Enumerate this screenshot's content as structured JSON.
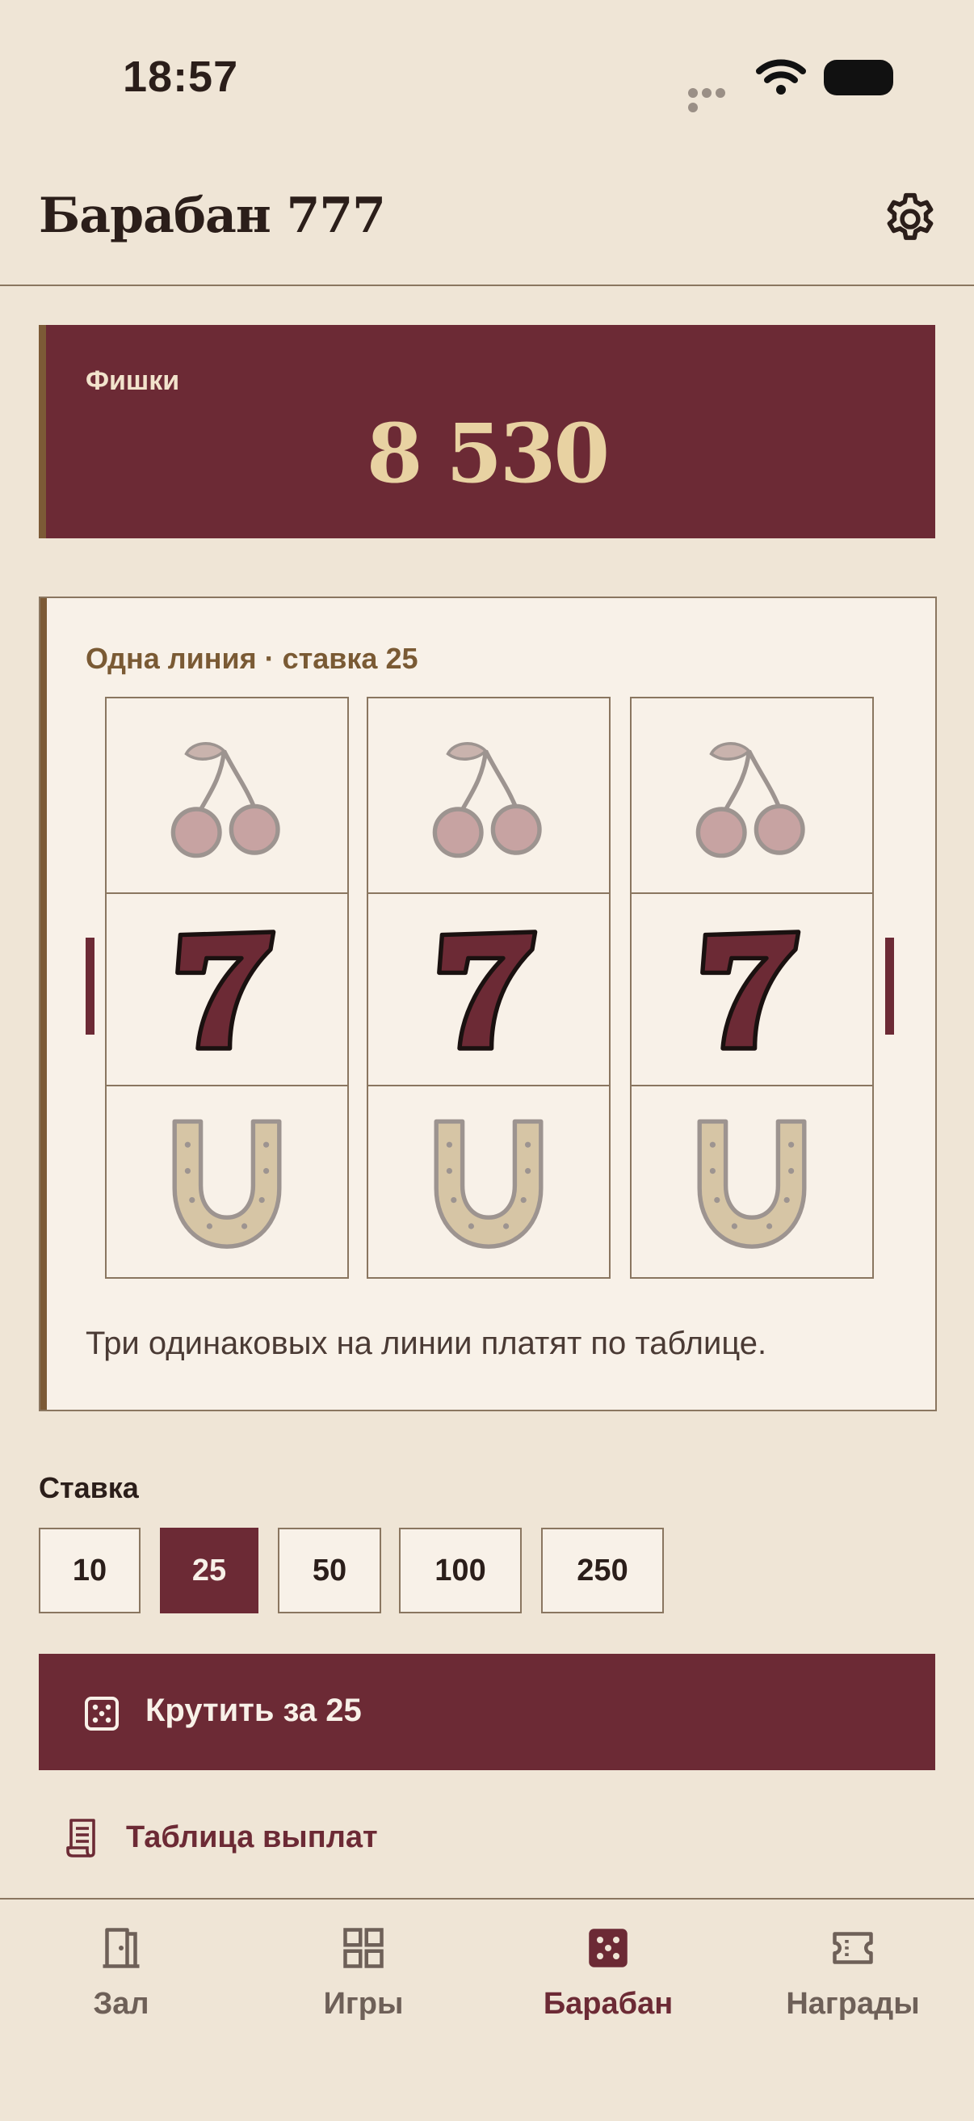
{
  "status_bar": {
    "time": "18:57"
  },
  "header": {
    "title": "Барабан 777",
    "settings_icon": "gear-icon"
  },
  "chips": {
    "label": "Фишки",
    "value": "8 530"
  },
  "slot": {
    "subtitle": "Одна линия · ставка 25",
    "reels": [
      [
        "cherry",
        "seven",
        "horseshoe"
      ],
      [
        "cherry",
        "seven",
        "horseshoe"
      ],
      [
        "cherry",
        "seven",
        "horseshoe"
      ]
    ],
    "hint": "Три одинаковых на линии платят по таблице."
  },
  "bet": {
    "label": "Ставка",
    "options": [
      "10",
      "25",
      "50",
      "100",
      "250"
    ],
    "selected": "25"
  },
  "spin": {
    "label": "Крутить за 25",
    "icon": "dice-icon"
  },
  "paytable": {
    "label": "Таблица выплат",
    "icon": "receipt-icon"
  },
  "tabs": [
    {
      "label": "Зал",
      "icon": "door-icon",
      "active": false
    },
    {
      "label": "Игры",
      "icon": "grid-icon",
      "active": false
    },
    {
      "label": "Барабан",
      "icon": "dice-icon",
      "active": true
    },
    {
      "label": "Награды",
      "icon": "ticket-icon",
      "active": false
    }
  ],
  "colors": {
    "background": "#efe5d6",
    "accent": "#6c2a35",
    "gold": "#e8d2a2",
    "border": "#8a7660"
  }
}
